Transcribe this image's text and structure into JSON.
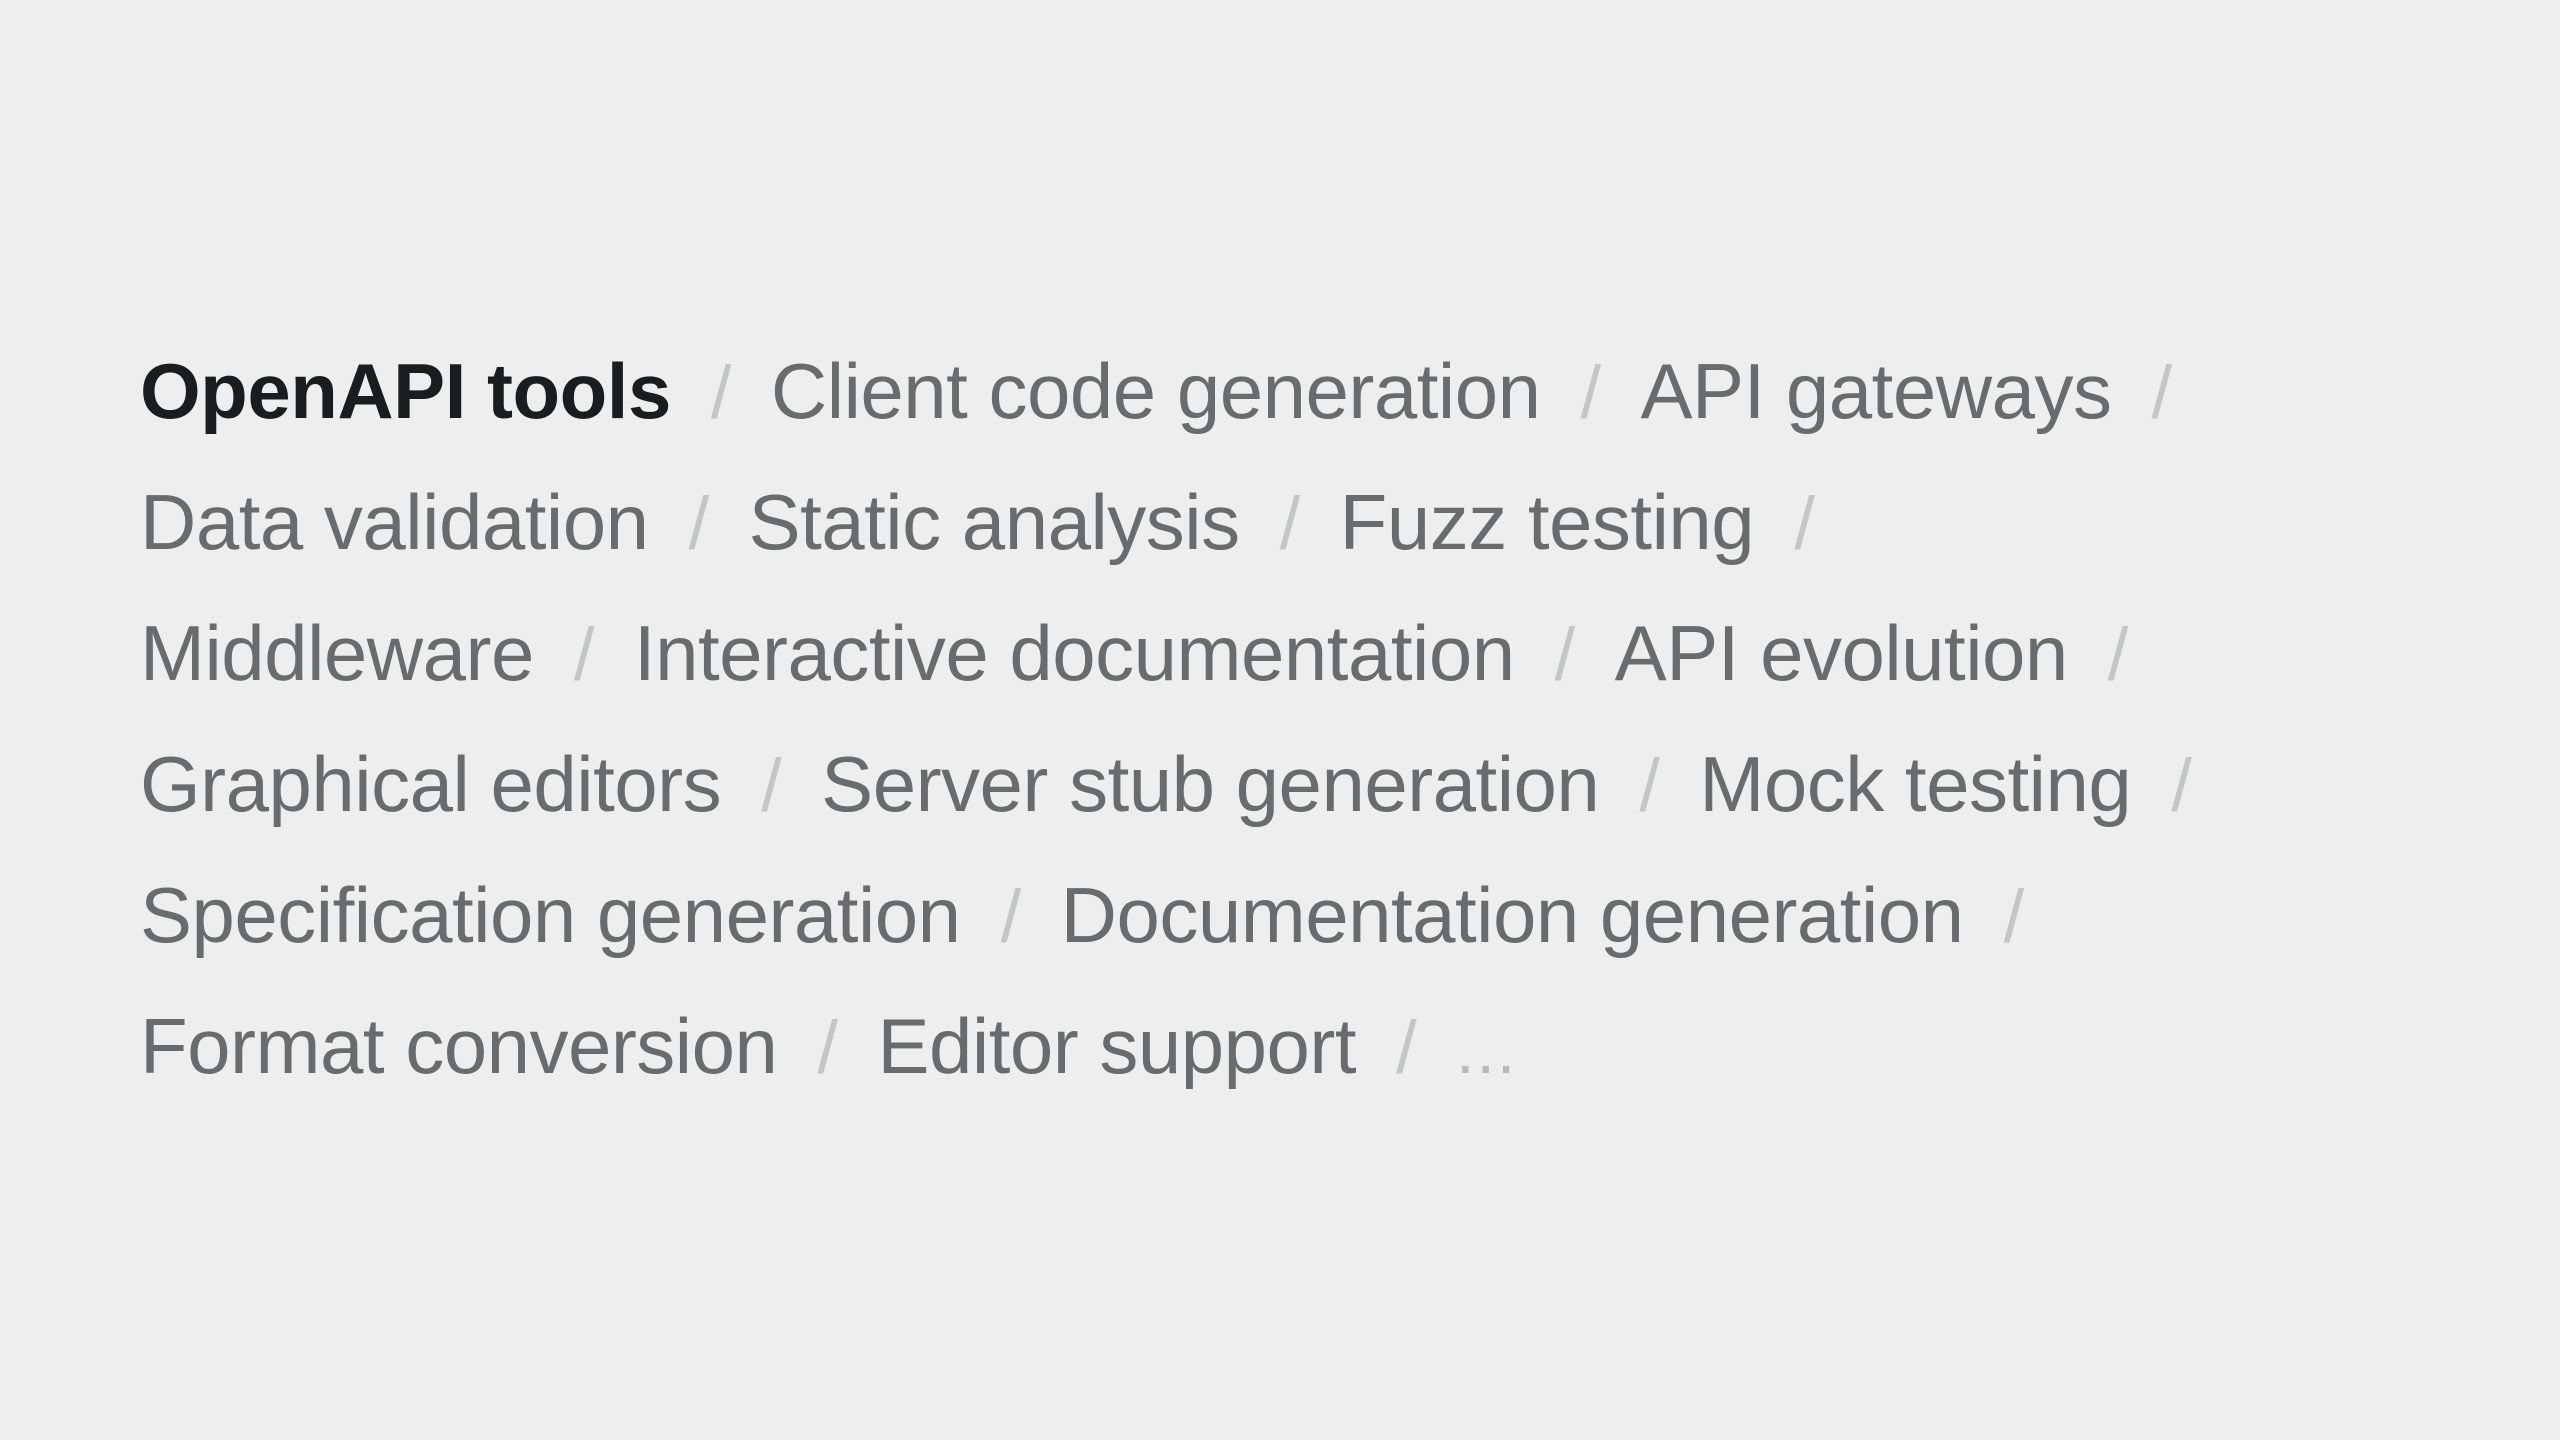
{
  "heading": "OpenAPI tools",
  "separator": "/",
  "rows": [
    [
      "Client code generation",
      "API gateways"
    ],
    [
      "Data validation",
      "Static analysis",
      "Fuzz testing"
    ],
    [
      "Middleware",
      "Interactive documentation",
      "API evolution"
    ],
    [
      "Graphical editors",
      "Server stub generation",
      "Mock testing"
    ],
    [
      "Specification generation",
      "Documentation generation"
    ],
    [
      "Format conversion",
      "Editor support"
    ]
  ],
  "ellipsis": "...",
  "colors": {
    "background": "#edeeed",
    "heading": "#1b1c1d",
    "item": "#6a6b6c",
    "separator": "#c4c5c5"
  }
}
